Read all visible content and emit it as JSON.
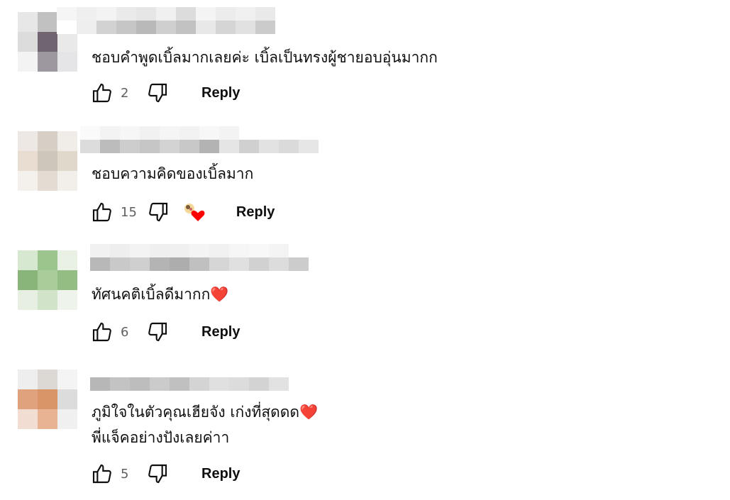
{
  "comments": [
    {
      "text_lines": [
        "ชอบคำพูดเบิ้ลมากเลยค่ะ เบิ้ลเป็นทรงผู้ชายอบอุ่นมากก"
      ],
      "likes": "2",
      "reply_label": "Reply",
      "has_creator_heart": false,
      "avatar_colors": [
        "#e7e7e7",
        "#c1c1c1",
        "#ececec",
        "#dcdcdc",
        "#6f6470",
        "#e9e9e9",
        "#f3f3f3",
        "#9d97a0",
        "#e5e5e8"
      ]
    },
    {
      "text_lines": [
        "ชอบความคิดของเบิ้ลมาก"
      ],
      "likes": "15",
      "reply_label": "Reply",
      "has_creator_heart": true,
      "avatar_colors": [
        "#ede8e4",
        "#d7cfc6",
        "#f0ece7",
        "#e8ddd0",
        "#cfc6bb",
        "#e1d8cc",
        "#f4f0ec",
        "#e4dcd2",
        "#f2eee9"
      ]
    },
    {
      "text_lines": [
        "ทัศนคติเบิ้ลดีมากก"
      ],
      "likes": "6",
      "reply_label": "Reply",
      "has_creator_heart": false,
      "trailing_emoji": "❤️",
      "avatar_colors": [
        "#d6e8cf",
        "#9cc48d",
        "#e8f1e4",
        "#8ab57a",
        "#a9cc9b",
        "#93bd82",
        "#e6efe2",
        "#d1e3c8",
        "#eef4eb"
      ]
    },
    {
      "text_lines": [
        "ภูมิใจในตัวคุณเฮียจัง เก่งที่สุดดด",
        "พี่แจ็คอย่างปังเลยค่าา"
      ],
      "likes": "5",
      "reply_label": "Reply",
      "has_creator_heart": false,
      "trailing_emoji": "❤️",
      "avatar_colors": [
        "#eeeeee",
        "#dcd8d4",
        "#f4f4f4",
        "#e0a27d",
        "#d99567",
        "#dcdcdc",
        "#f1ddd2",
        "#e8b393",
        "#f0f0f0"
      ]
    }
  ],
  "colors": {
    "text": "#0f0f0f",
    "meta": "#606060",
    "heart": "#e0245e"
  },
  "icons": {
    "like": "thumbs-up-icon",
    "dislike": "thumbs-down-icon",
    "creator_heart": "creator-heart-icon",
    "trailing": "red-heart-emoji"
  }
}
